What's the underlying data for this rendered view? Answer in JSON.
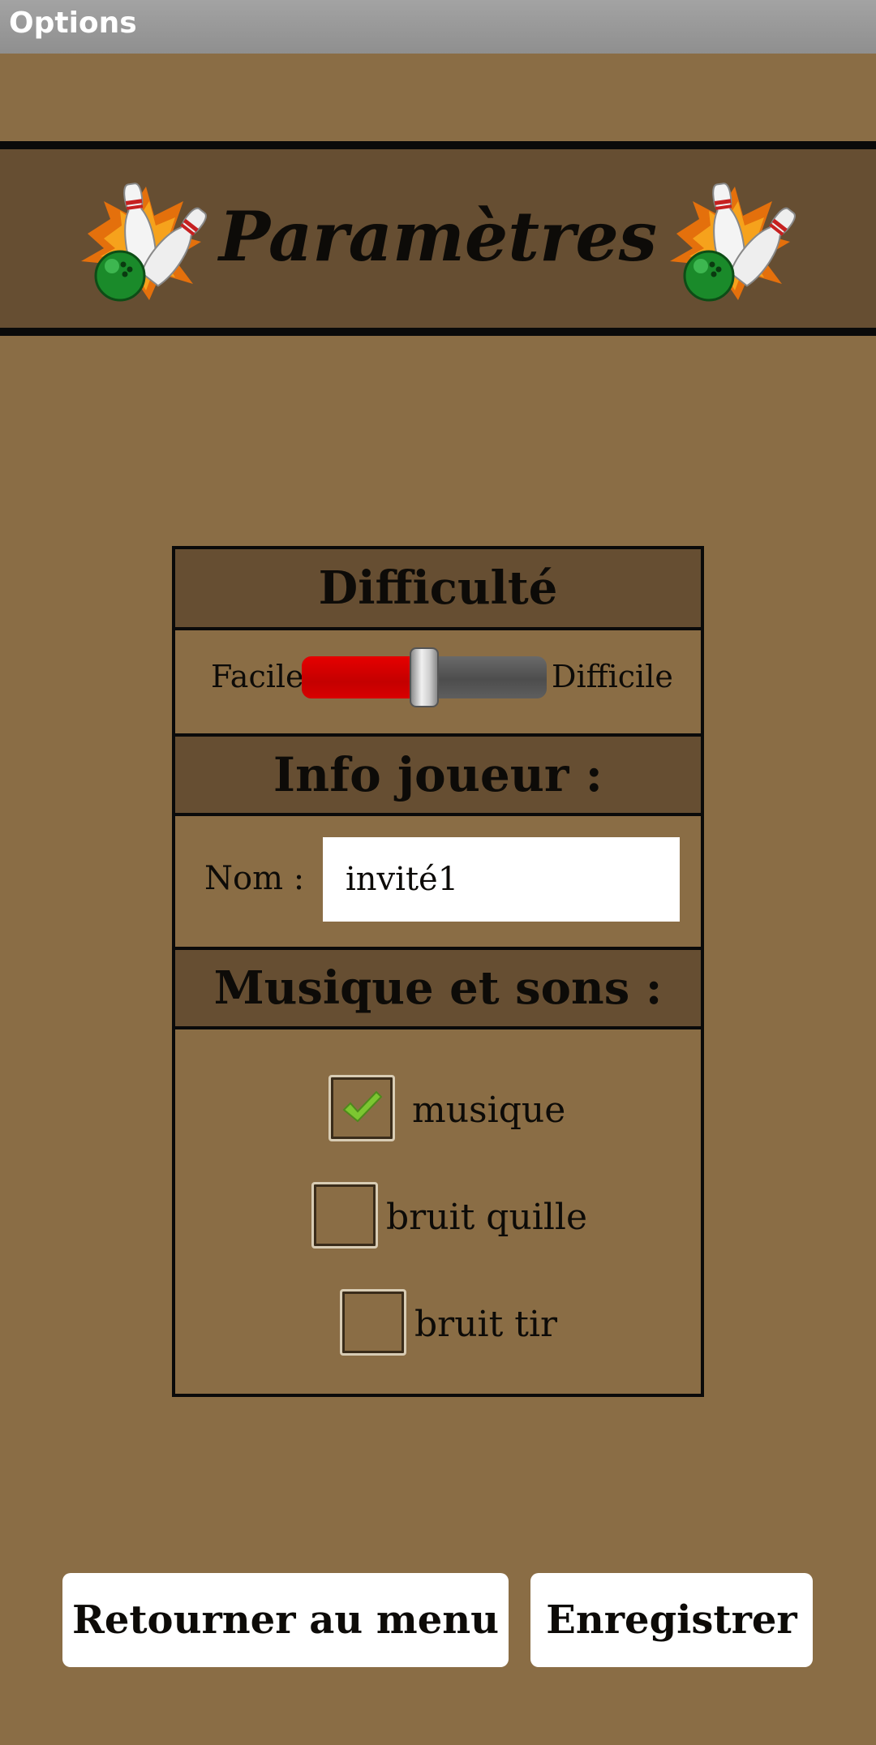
{
  "window": {
    "title": "Options"
  },
  "banner": {
    "title": "Paramètres",
    "icon_left": "bowling-pins-icon",
    "icon_right": "bowling-pins-icon"
  },
  "difficulty": {
    "heading": "Difficulté",
    "min_label": "Facile",
    "max_label": "Difficile",
    "level": 0.5
  },
  "player": {
    "heading": "Info joueur :",
    "name_label": "Nom :",
    "name_value": "invité1"
  },
  "sound": {
    "heading": "Musique et sons :",
    "options": [
      {
        "label": "musique",
        "checked": true
      },
      {
        "label": "bruit quille",
        "checked": false
      },
      {
        "label": "bruit tir",
        "checked": false
      }
    ]
  },
  "buttons": {
    "back": "Retourner au menu",
    "save": "Enregistrer"
  },
  "colors": {
    "background": "#8a6d45",
    "header_fill": "#664e32",
    "slider_fill": "#d80000",
    "check": "#7cc631"
  }
}
